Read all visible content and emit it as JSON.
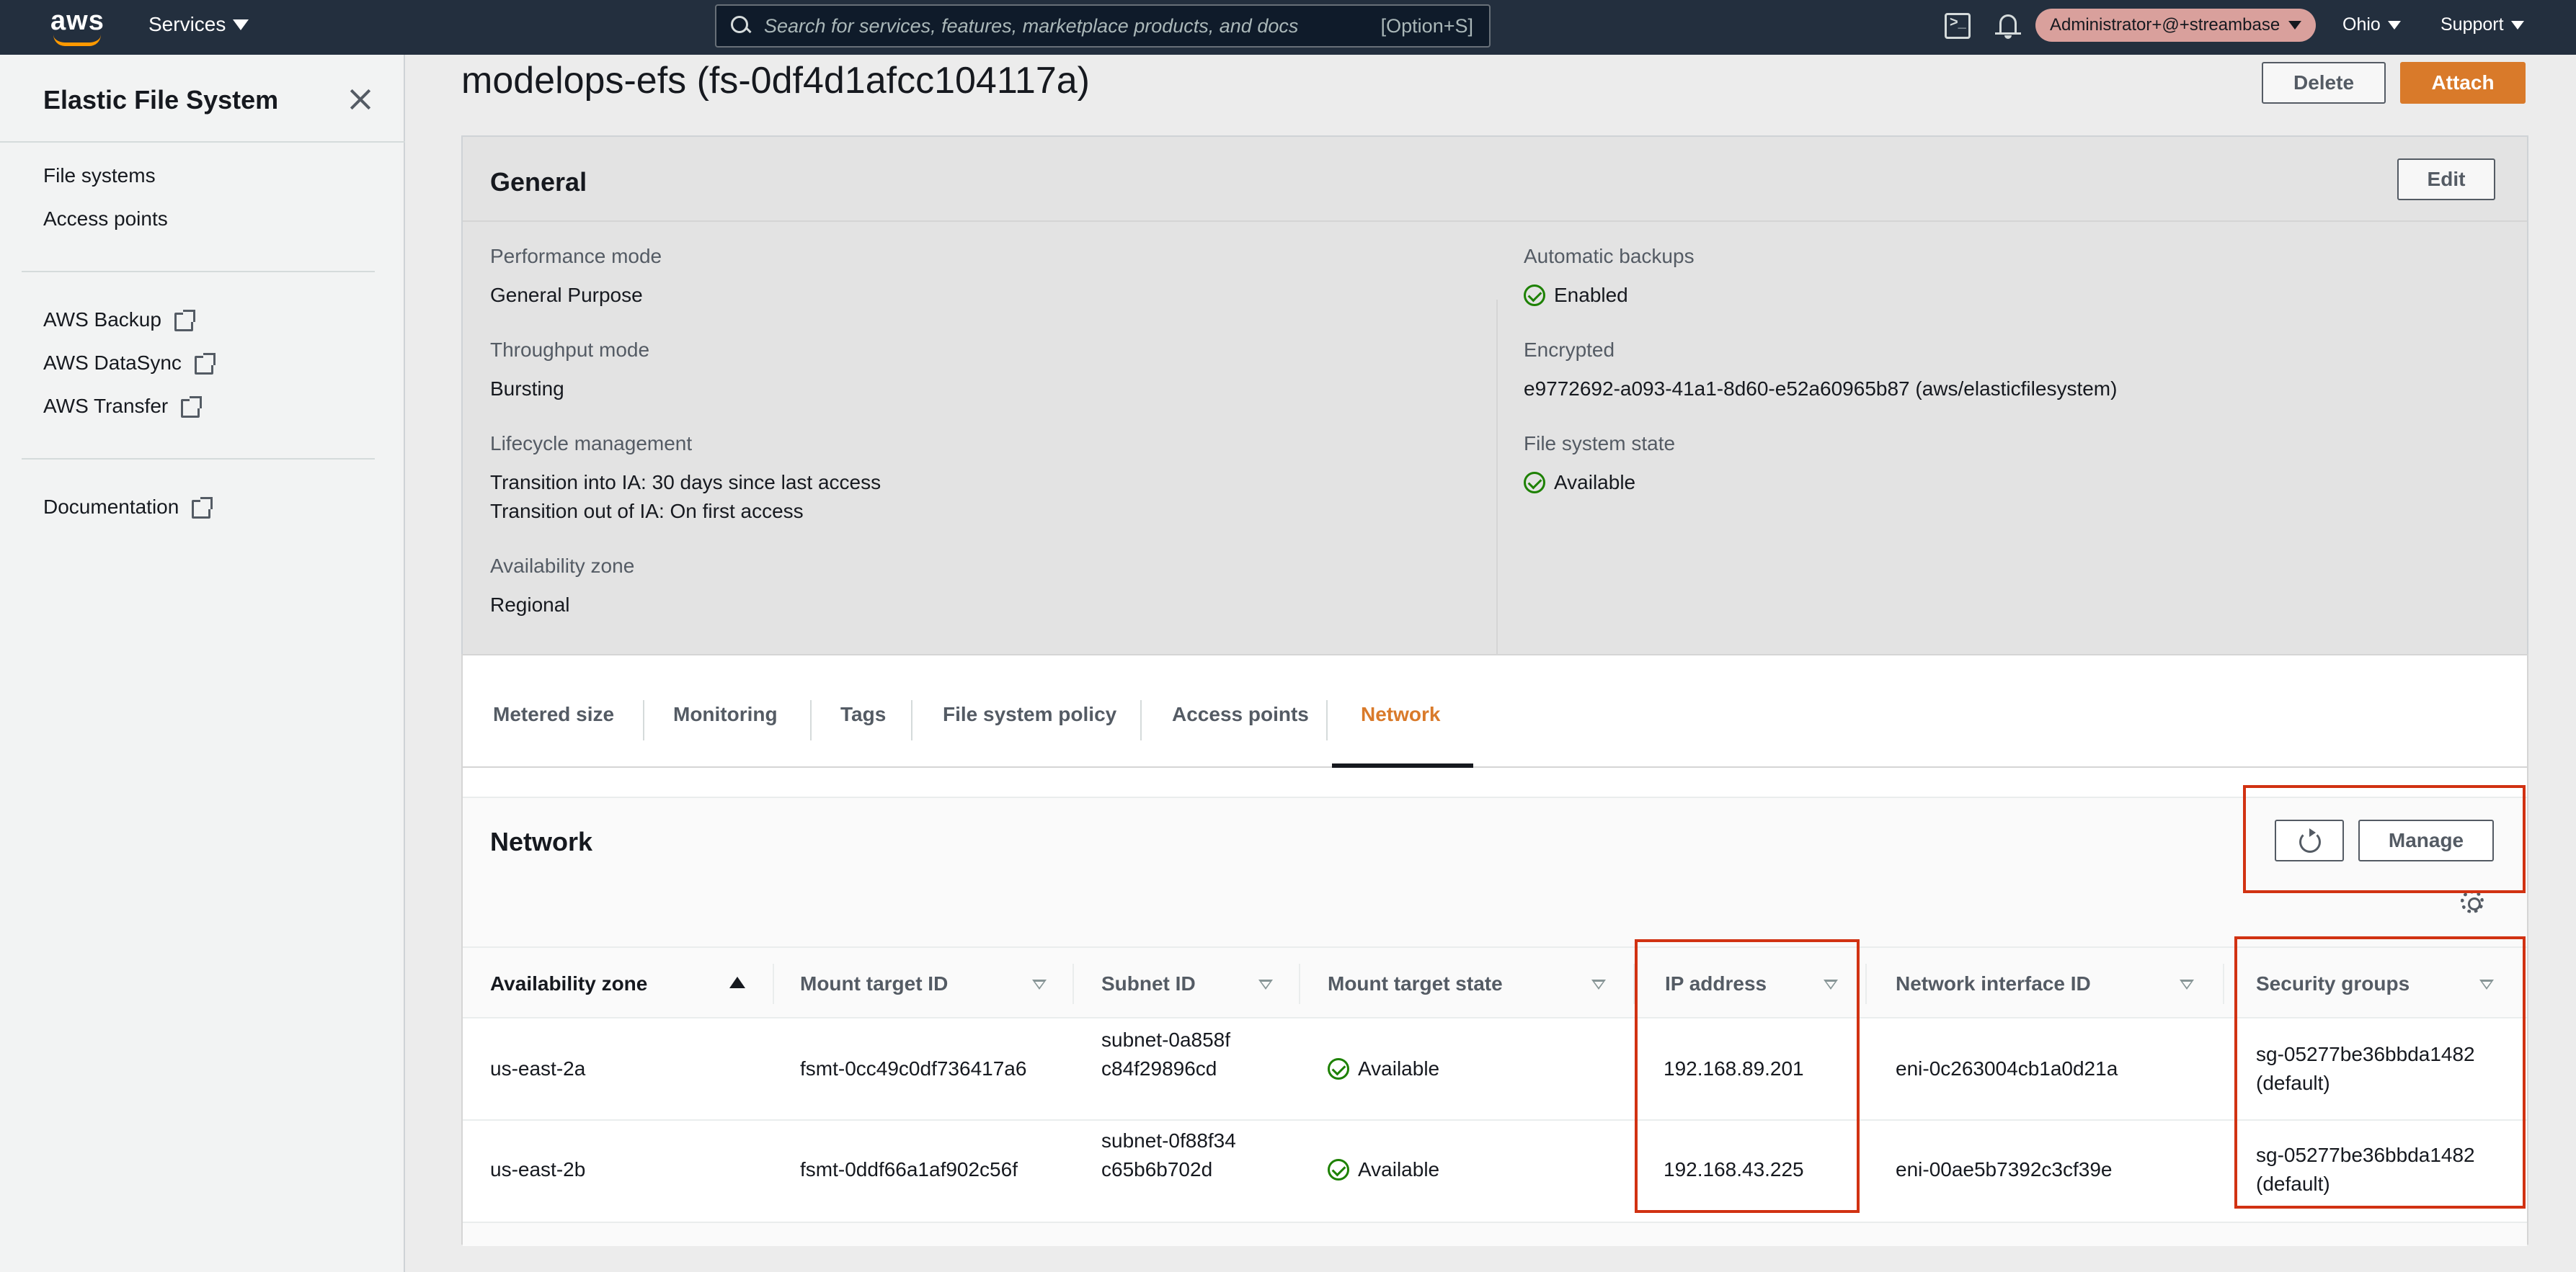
{
  "topnav": {
    "logo": "aws",
    "services": "Services",
    "search_placeholder": "Search for services, features, marketplace products, and docs",
    "search_shortcut": "[Option+S]",
    "account": "Administrator+@+streambase",
    "region": "Ohio",
    "support": "Support"
  },
  "sidebar": {
    "title": "Elastic File System",
    "items": [
      {
        "label": "File systems"
      },
      {
        "label": "Access points"
      },
      {
        "label": "AWS Backup"
      },
      {
        "label": "AWS DataSync"
      },
      {
        "label": "AWS Transfer"
      },
      {
        "label": "Documentation"
      }
    ]
  },
  "page": {
    "title": "modelops-efs (fs-0df4d1afcc104117a)",
    "delete": "Delete",
    "attach": "Attach"
  },
  "general": {
    "heading": "General",
    "edit": "Edit",
    "performance_mode": {
      "label": "Performance mode",
      "value": "General Purpose"
    },
    "throughput_mode": {
      "label": "Throughput mode",
      "value": "Bursting"
    },
    "lifecycle": {
      "label": "Lifecycle management",
      "line1": "Transition into IA: 30 days since last access",
      "line2": "Transition out of IA: On first access"
    },
    "availability_zone": {
      "label": "Availability zone",
      "value": "Regional"
    },
    "automatic_backups": {
      "label": "Automatic backups",
      "value": "Enabled"
    },
    "encrypted": {
      "label": "Encrypted",
      "value": "e9772692-a093-41a1-8d60-e52a60965b87 (aws/elasticfilesystem)"
    },
    "fs_state": {
      "label": "File system state",
      "value": "Available"
    }
  },
  "tabs": [
    "Metered size",
    "Monitoring",
    "Tags",
    "File system policy",
    "Access points",
    "Network"
  ],
  "network": {
    "heading": "Network",
    "manage": "Manage",
    "columns": [
      "Availability zone",
      "Mount target ID",
      "Subnet ID",
      "Mount target state",
      "IP address",
      "Network interface ID",
      "Security groups"
    ],
    "rows": [
      {
        "az": "us-east-2a",
        "mount_target_id": "fsmt-0cc49c0df736417a6",
        "subnet_id": "subnet-0a858fc84f29896cd",
        "state": "Available",
        "ip": "192.168.89.201",
        "eni": "eni-0c263004cb1a0d21a",
        "sg": "sg-05277be36bbda1482",
        "sg_note": "(default)"
      },
      {
        "az": "us-east-2b",
        "mount_target_id": "fsmt-0ddf66a1af902c56f",
        "subnet_id": "subnet-0f88f34c65b6b702d",
        "state": "Available",
        "ip": "192.168.43.225",
        "eni": "eni-00ae5b7392c3cf39e",
        "sg": "sg-05277be36bbda1482",
        "sg_note": "(default)"
      }
    ]
  },
  "colors": {
    "nav_bg": "#232f3e",
    "accent_orange": "#d97a2a",
    "success_green": "#1d8102",
    "highlight_red": "#d13212"
  }
}
